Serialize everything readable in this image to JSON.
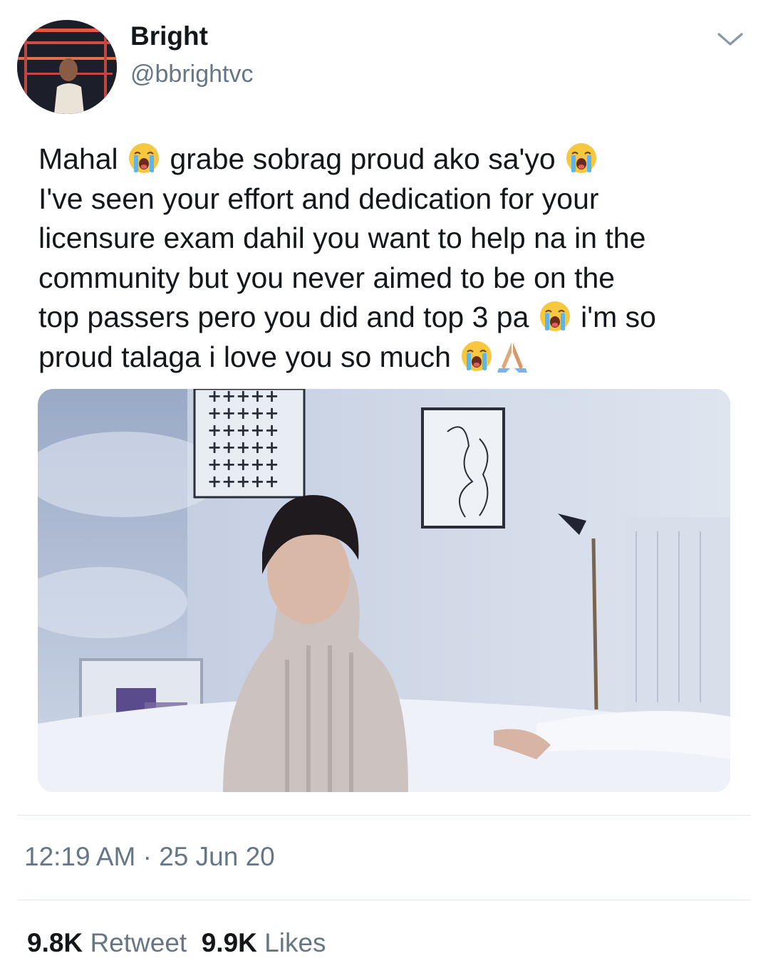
{
  "author": {
    "name": "Bright",
    "handle": "@bbrightvc",
    "avatar_icon": "profile-photo",
    "menu_icon": "chevron-down-icon"
  },
  "tweet": {
    "lines": [
      {
        "parts": [
          "Mahal ",
          "loudly-crying-face",
          " grabe sobrag proud ako sa'yo ",
          "loudly-crying-face"
        ]
      },
      {
        "parts": [
          "I've seen your effort and dedication for your"
        ]
      },
      {
        "parts": [
          "licensure exam dahil you want to help na in the"
        ]
      },
      {
        "parts": [
          "community but you never aimed to be on the"
        ]
      },
      {
        "parts": [
          "top passers pero you did and top 3 pa ",
          "loudly-crying-face",
          " i'm so"
        ]
      },
      {
        "parts": [
          "proud talaga i love you so much ",
          "loudly-crying-face",
          "folded-hands"
        ]
      }
    ],
    "media": "photo"
  },
  "timestamp": "12:19 AM · 25 Jun 20",
  "stats": {
    "retweets_count": "9.8K",
    "retweets_label": "Retweet",
    "likes_count": "9.9K",
    "likes_label": "Likes"
  },
  "colors": {
    "text": "#14171a",
    "secondary": "#657786",
    "divider": "#e1e8ed"
  }
}
